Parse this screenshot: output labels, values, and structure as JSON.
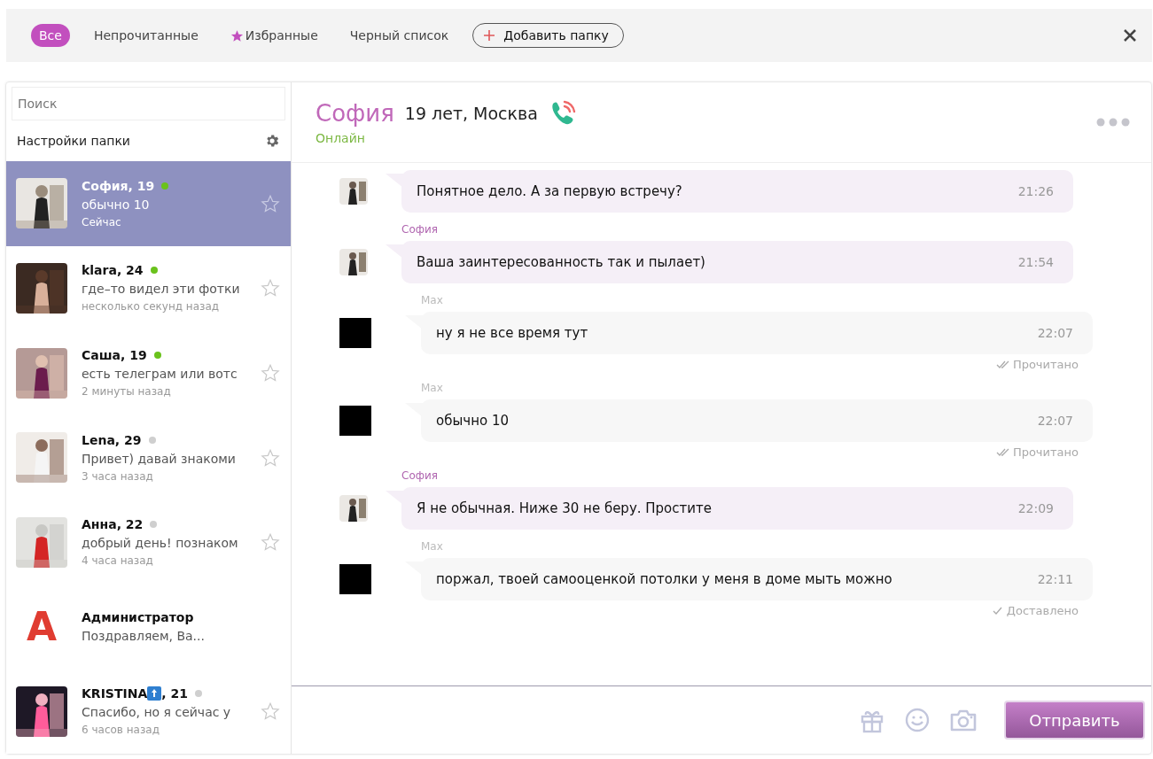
{
  "tabs": [
    {
      "kind": "plain",
      "label": "Все",
      "selected": true
    },
    {
      "kind": "plain",
      "label": "Непрочитанные",
      "selected": false
    },
    {
      "kind": "starred",
      "label": "Избранные",
      "selected": false
    },
    {
      "kind": "plain",
      "label": "Черный список",
      "selected": false
    }
  ],
  "add_folder": {
    "label": "Добавить папку"
  },
  "search": {
    "placeholder": "Поиск"
  },
  "folder_settings": {
    "label": "Настройки папки"
  },
  "contacts": [
    {
      "kind": "user",
      "name": "София, 19",
      "online": true,
      "preview": "обычно 10",
      "time": "Сейчас",
      "selected": true
    },
    {
      "kind": "user",
      "name": "klara, 24",
      "online": true,
      "preview": "где–то видел эти фотки",
      "time": "несколько секунд назад",
      "selected": false
    },
    {
      "kind": "user",
      "name": "Саша, 19",
      "online": true,
      "preview": "есть телеграм или вотс",
      "time": "2 минуты назад",
      "selected": false
    },
    {
      "kind": "user",
      "name": "Lena, 29",
      "online": false,
      "preview": "Привет) давай знакоми",
      "time": "3 часа назад",
      "selected": false
    },
    {
      "kind": "user",
      "name": "Анна, 22",
      "online": false,
      "preview": "добрый день! познаком",
      "time": "4 часа назад",
      "selected": false
    },
    {
      "kind": "admin",
      "letter": "А",
      "name": "Администратор",
      "preview": "Поздравляем, Ва...",
      "selected": false
    },
    {
      "kind": "user",
      "name": "KRISTINA",
      "top_badge": true,
      "name_rest": ", 21",
      "online": false,
      "preview": "Спасибо, но я сейчас у",
      "time": "6 часов назад",
      "selected": false
    }
  ],
  "chat": {
    "name": "София",
    "info": "19 лет, Москва",
    "status": "Онлайн"
  },
  "messages": [
    {
      "kind": "incoming",
      "text": "Понятное дело. А за первую встречу?",
      "time": "21:26"
    },
    {
      "kind": "incoming",
      "sender": "София",
      "text": "Ваша заинтересованность так и пылает)",
      "time": "21:54"
    },
    {
      "kind": "outgoing",
      "sender": "Max",
      "text": "ну я не все время тут",
      "time": "22:07",
      "read": true,
      "status_text": "Прочитано"
    },
    {
      "kind": "outgoing",
      "sender": "Max",
      "text": "обычно 10",
      "time": "22:07",
      "read": true,
      "status_text": "Прочитано"
    },
    {
      "kind": "incoming",
      "sender": "София",
      "text": "Я не обычная. Ниже 30 не беру. Простите",
      "time": "22:09"
    },
    {
      "kind": "outgoing",
      "sender": "Max",
      "text": "поржал, твоей самооценкой потолки у меня в доме мыть можно",
      "time": "22:11",
      "read": false,
      "status_text": "Доставлено"
    }
  ],
  "send_button": {
    "label": "Отправить"
  }
}
